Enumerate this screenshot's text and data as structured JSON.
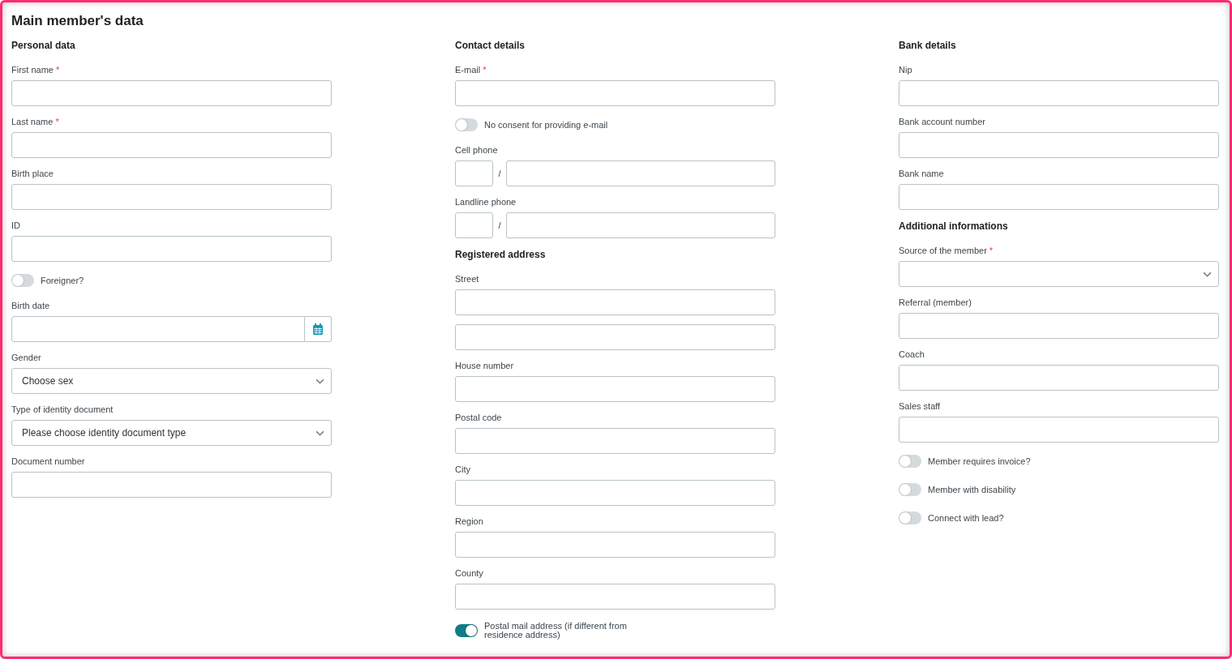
{
  "title": "Main member's data",
  "columns": [
    [
      {
        "kind": "heading",
        "text": "Personal data"
      },
      {
        "kind": "field",
        "label": "First name",
        "marker": "*"
      },
      {
        "kind": "field",
        "label": "Last name",
        "marker": "*"
      },
      {
        "kind": "field",
        "label": "Birth place"
      },
      {
        "kind": "field",
        "label": "ID"
      },
      {
        "kind": "toggle",
        "label": "Foreigner?",
        "on": false
      },
      {
        "kind": "date",
        "label": "Birth date"
      },
      {
        "kind": "select",
        "label": "Gender",
        "value": "Choose sex"
      },
      {
        "kind": "select",
        "label": "Type of identity document",
        "value": "Please choose identity document type"
      },
      {
        "kind": "field",
        "label": "Document number"
      }
    ],
    [
      {
        "kind": "heading",
        "text": "Contact details"
      },
      {
        "kind": "field",
        "label": "E-mail",
        "marker": "*"
      },
      {
        "kind": "toggle",
        "label": "No consent for providing e-mail",
        "on": false
      },
      {
        "kind": "phone",
        "label": "Cell phone",
        "separator": "/"
      },
      {
        "kind": "phone",
        "label": "Landline phone",
        "separator": "/"
      },
      {
        "kind": "heading",
        "text": "Registered address"
      },
      {
        "kind": "field",
        "label": "Street"
      },
      {
        "kind": "input"
      },
      {
        "kind": "field",
        "label": "House number"
      },
      {
        "kind": "field",
        "label": "Postal code"
      },
      {
        "kind": "field",
        "label": "City"
      },
      {
        "kind": "field",
        "label": "Region"
      },
      {
        "kind": "field",
        "label": "County"
      },
      {
        "kind": "toggle",
        "label": "Postal mail address (if different from residence address)",
        "on": true
      }
    ],
    [
      {
        "kind": "heading",
        "text": "Bank details"
      },
      {
        "kind": "field",
        "label": "Nip"
      },
      {
        "kind": "field",
        "label": "Bank account number"
      },
      {
        "kind": "field",
        "label": "Bank name"
      },
      {
        "kind": "heading",
        "text": "Additional informations"
      },
      {
        "kind": "select",
        "label": "Source of the member",
        "marker": "*"
      },
      {
        "kind": "field",
        "label": "Referral (member)"
      },
      {
        "kind": "field",
        "label": "Coach"
      },
      {
        "kind": "field",
        "label": "Sales staff"
      },
      {
        "kind": "toggle",
        "label": "Member requires invoice?",
        "on": false
      },
      {
        "kind": "toggle",
        "label": "Member with disability",
        "on": false
      },
      {
        "kind": "toggle",
        "label": "Connect with lead?",
        "on": false
      }
    ]
  ]
}
